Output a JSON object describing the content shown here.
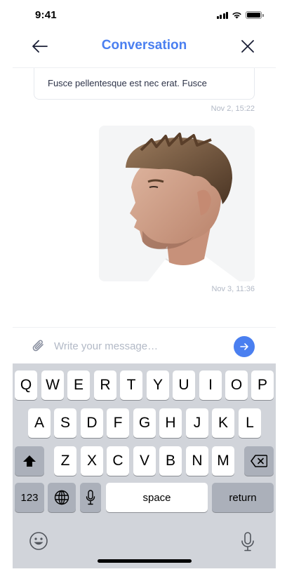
{
  "status_bar": {
    "time": "9:41"
  },
  "header": {
    "title": "Conversation"
  },
  "messages": [
    {
      "text": "Fusce pellentesque est nec erat. Fusce",
      "time": "Nov 2, 15:22"
    },
    {
      "photo_subject": "man-profile-photo",
      "time": "Nov 3, 11:36"
    }
  ],
  "composer": {
    "placeholder": "Write your message…"
  },
  "keyboard": {
    "row1": [
      "Q",
      "W",
      "E",
      "R",
      "T",
      "Y",
      "U",
      "I",
      "O",
      "P"
    ],
    "row2": [
      "A",
      "S",
      "D",
      "F",
      "G",
      "H",
      "J",
      "K",
      "L"
    ],
    "row3": [
      "Z",
      "X",
      "C",
      "V",
      "B",
      "N",
      "M"
    ],
    "numbers_label": "123",
    "space_label": "space",
    "return_label": "return"
  },
  "colors": {
    "accent": "#4a7ff0",
    "keyboard_bg": "#d1d4da",
    "time_text": "#b2b9c6"
  }
}
